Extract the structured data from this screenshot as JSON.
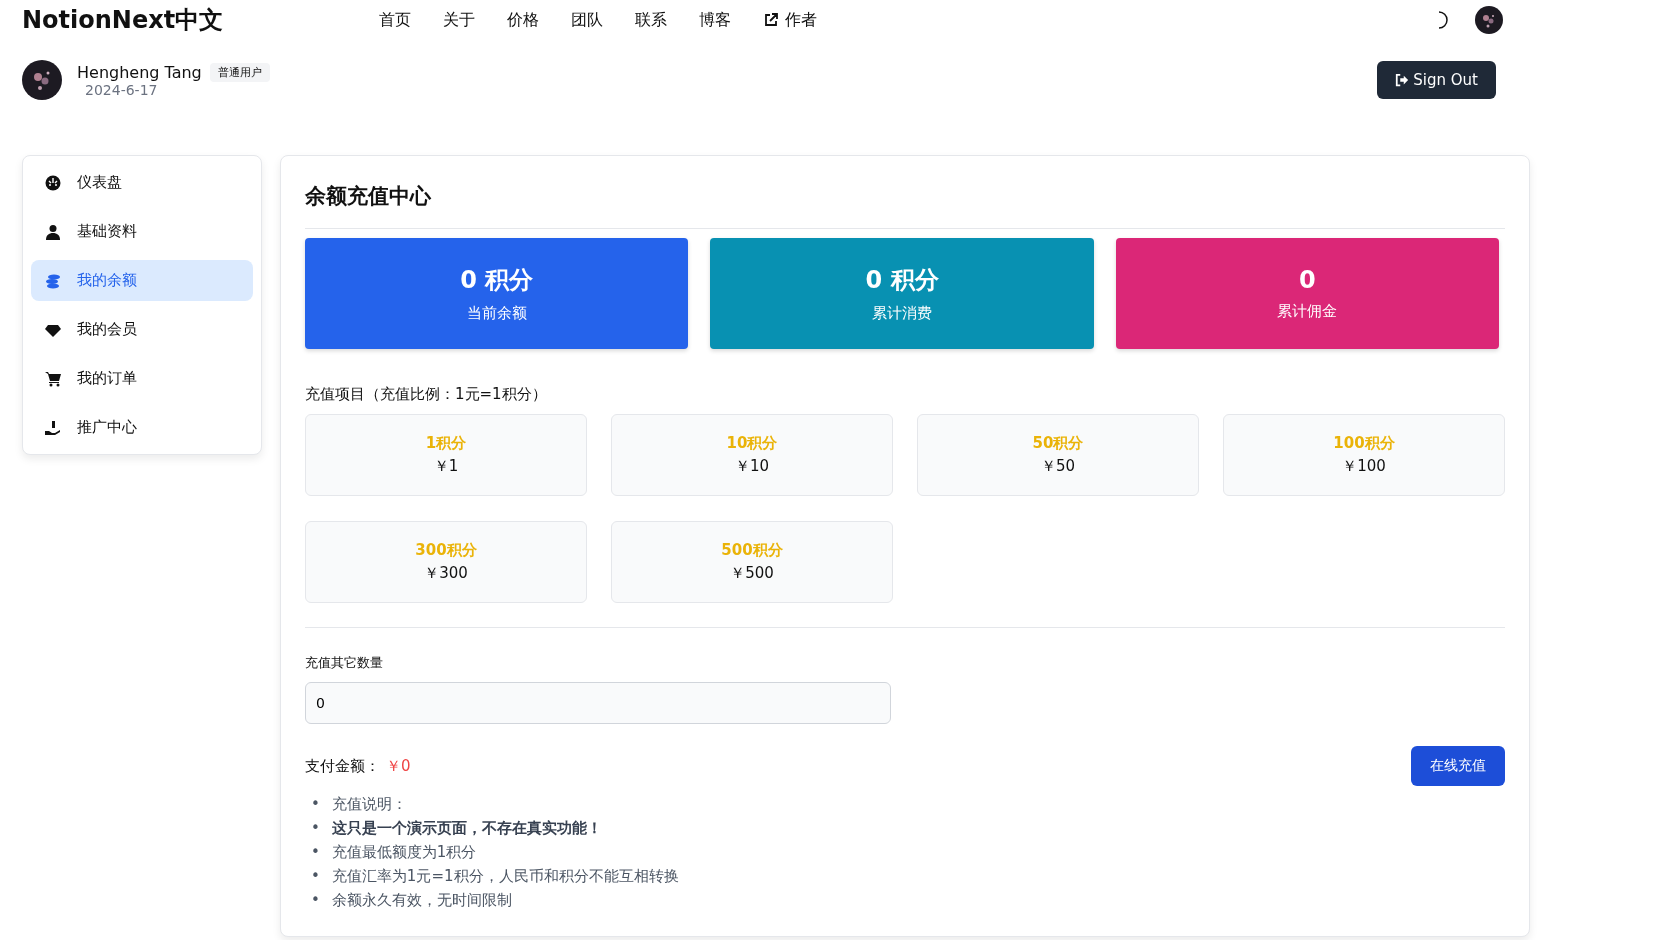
{
  "header": {
    "logo": "NotionNext中文",
    "nav": [
      {
        "label": "首页",
        "external": false
      },
      {
        "label": "关于",
        "external": false
      },
      {
        "label": "价格",
        "external": false
      },
      {
        "label": "团队",
        "external": false
      },
      {
        "label": "联系",
        "external": false
      },
      {
        "label": "博客",
        "external": false
      },
      {
        "label": "作者",
        "external": true
      }
    ]
  },
  "user": {
    "name": "Hengheng Tang",
    "badge": "普通用户",
    "date": "2024-6-17",
    "sign_out": "Sign Out"
  },
  "sidebar": {
    "items": [
      {
        "kind": "dashboard",
        "label": "仪表盘",
        "selected": false
      },
      {
        "kind": "profile",
        "label": "基础资料",
        "selected": false
      },
      {
        "kind": "balance",
        "label": "我的余额",
        "selected": true
      },
      {
        "kind": "member",
        "label": "我的会员",
        "selected": false
      },
      {
        "kind": "orders",
        "label": "我的订单",
        "selected": false
      },
      {
        "kind": "promo",
        "label": "推广中心",
        "selected": false
      }
    ]
  },
  "main": {
    "title": "余额充值中心",
    "stats": [
      {
        "value": "0 积分",
        "label": "当前余额",
        "color": "#2563eb"
      },
      {
        "value": "0 积分",
        "label": "累计消费",
        "color": "#0891b2"
      },
      {
        "value": "0",
        "label": "累计佣金",
        "color": "#db2777"
      }
    ],
    "packages_title": "充值项目（充值比例：1元=1积分）",
    "packages": [
      {
        "points": "1积分",
        "price": "￥1"
      },
      {
        "points": "10积分",
        "price": "￥10"
      },
      {
        "points": "50积分",
        "price": "￥50"
      },
      {
        "points": "100积分",
        "price": "￥100"
      },
      {
        "points": "300积分",
        "price": "￥300"
      },
      {
        "points": "500积分",
        "price": "￥500"
      }
    ],
    "custom_label": "充值其它数量",
    "custom_value": "0",
    "pay_label": "支付金额：",
    "pay_amount": "￥0",
    "pay_button": "在线充值",
    "notes": [
      {
        "marker": "•",
        "text": "充值说明：",
        "bold": false
      },
      {
        "marker": "•",
        "text": "这只是一个演示页面，不存在真实功能！",
        "bold": true
      },
      {
        "marker": "•",
        "text": "充值最低额度为1积分",
        "bold": false
      },
      {
        "marker": "•",
        "text": "充值汇率为1元=1积分，人民币和积分不能互相转换",
        "bold": false
      },
      {
        "marker": "•",
        "text": "余额永久有效，无时间限制",
        "bold": false
      }
    ]
  }
}
